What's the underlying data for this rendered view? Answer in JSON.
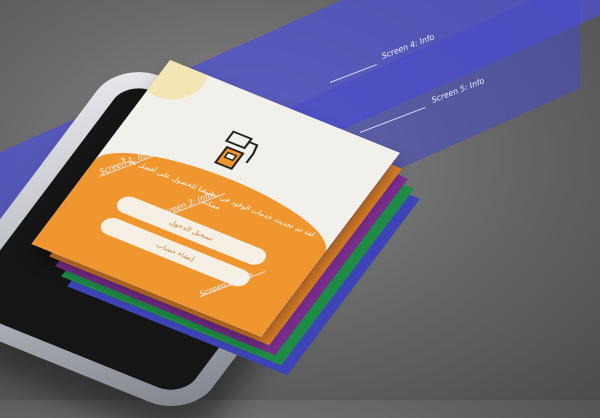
{
  "callouts": {
    "screen1": "Screen 1: Info",
    "screen2": "Screen 2: Info",
    "screen3": "Screen 3: Info",
    "screen4": "Screen 4: Info",
    "screen5": "Screen 5: Info"
  },
  "app": {
    "message": "لقد تم تحديث خدمات الوقود في تطبيقنا للحصول على أفضل تجربة ممكنة",
    "button_primary": "تسجيل الدخول",
    "button_secondary": "إنشاء حساب"
  },
  "colors": {
    "accent_orange": "#f0962e",
    "band_blue": "#4e52d2",
    "layer_purple": "#7a2e8f",
    "layer_green": "#1f8c46",
    "layer_blue": "#3e44b7"
  },
  "icons": [
    "fuel-pump-icon",
    "sun-shape"
  ]
}
